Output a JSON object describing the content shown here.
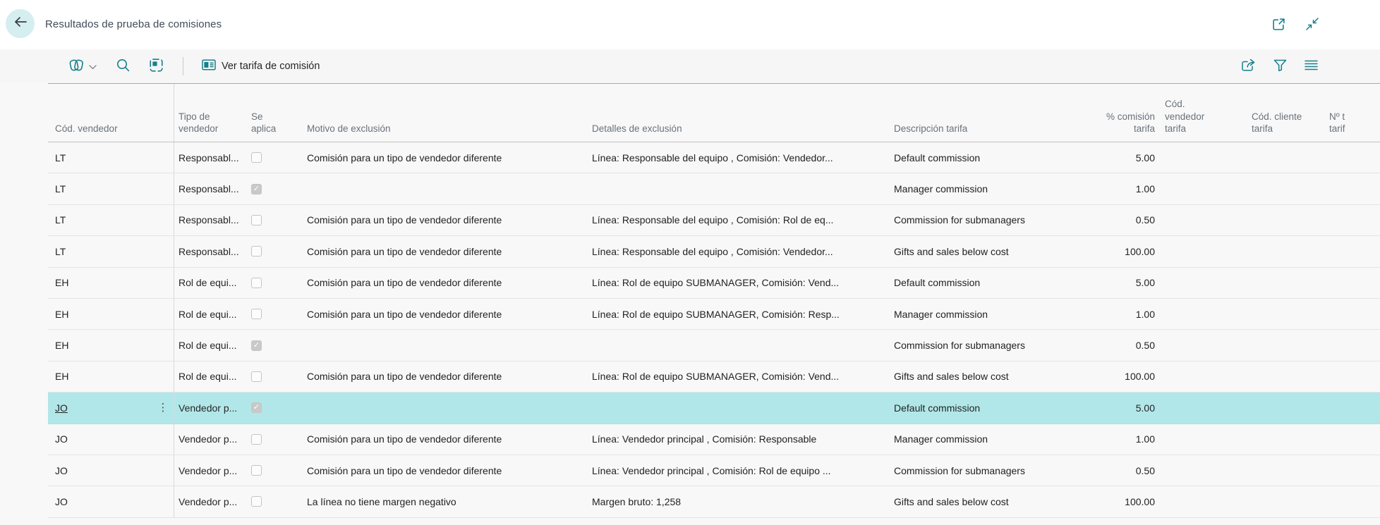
{
  "header": {
    "title": "Resultados de prueba de comisiones",
    "icons": [
      "back-arrow-icon",
      "open-in-new-window-icon",
      "collapse-icon"
    ]
  },
  "toolbar": {
    "icons": [
      "related-pages-icon",
      "chevron-down-icon",
      "search-icon",
      "analyze-icon",
      "card-icon",
      "share-icon",
      "filter-icon",
      "list-options-icon"
    ],
    "action_label": "Ver tarifa de comisión"
  },
  "colors": {
    "accent_teal": "#15808b",
    "selected_row_bg": "#b2e7e9",
    "back_circle_bg": "#d5eef0"
  },
  "table": {
    "columns": [
      {
        "label": "Cód. vendedor"
      },
      {
        "label": ""
      },
      {
        "label": "Tipo de\nvendedor"
      },
      {
        "label": "Se\naplica"
      },
      {
        "label": "Motivo de exclusión"
      },
      {
        "label": "Detalles de exclusión"
      },
      {
        "label": "Descripción tarifa"
      },
      {
        "label": "% comisión\ntarifa"
      },
      {
        "label": "Cód.\nvendedor\ntarifa"
      },
      {
        "label": "Cód. cliente\ntarifa"
      },
      {
        "label": "Nº t\ntarif"
      }
    ],
    "rows": [
      {
        "cod": "LT",
        "tipo": "Responsabl...",
        "aplica": false,
        "motivo": "Comisión para un tipo de vendedor diferente",
        "detalles": "Línea: Responsable del equipo , Comisión: Vendedor...",
        "desc": "Default commission",
        "pct": "5.00",
        "codv": "",
        "codc": "",
        "num": "",
        "selected": false
      },
      {
        "cod": "LT",
        "tipo": "Responsabl...",
        "aplica": true,
        "motivo": "",
        "detalles": "",
        "desc": "Manager commission",
        "pct": "1.00",
        "codv": "",
        "codc": "",
        "num": "",
        "selected": false
      },
      {
        "cod": "LT",
        "tipo": "Responsabl...",
        "aplica": false,
        "motivo": "Comisión para un tipo de vendedor diferente",
        "detalles": "Línea: Responsable del equipo , Comisión: Rol de eq...",
        "desc": "Commission for submanagers",
        "pct": "0.50",
        "codv": "",
        "codc": "",
        "num": "",
        "selected": false
      },
      {
        "cod": "LT",
        "tipo": "Responsabl...",
        "aplica": false,
        "motivo": "Comisión para un tipo de vendedor diferente",
        "detalles": "Línea: Responsable del equipo , Comisión: Vendedor...",
        "desc": "Gifts and sales below cost",
        "pct": "100.00",
        "codv": "",
        "codc": "",
        "num": "",
        "selected": false
      },
      {
        "cod": "EH",
        "tipo": "Rol de equi...",
        "aplica": false,
        "motivo": "Comisión para un tipo de vendedor diferente",
        "detalles": "Línea: Rol de equipo SUBMANAGER, Comisión: Vend...",
        "desc": "Default commission",
        "pct": "5.00",
        "codv": "",
        "codc": "",
        "num": "",
        "selected": false
      },
      {
        "cod": "EH",
        "tipo": "Rol de equi...",
        "aplica": false,
        "motivo": "Comisión para un tipo de vendedor diferente",
        "detalles": "Línea: Rol de equipo SUBMANAGER, Comisión: Resp...",
        "desc": "Manager commission",
        "pct": "1.00",
        "codv": "",
        "codc": "",
        "num": "",
        "selected": false
      },
      {
        "cod": "EH",
        "tipo": "Rol de equi...",
        "aplica": true,
        "motivo": "",
        "detalles": "",
        "desc": "Commission for submanagers",
        "pct": "0.50",
        "codv": "",
        "codc": "",
        "num": "",
        "selected": false
      },
      {
        "cod": "EH",
        "tipo": "Rol de equi...",
        "aplica": false,
        "motivo": "Comisión para un tipo de vendedor diferente",
        "detalles": "Línea: Rol de equipo SUBMANAGER, Comisión: Vend...",
        "desc": "Gifts and sales below cost",
        "pct": "100.00",
        "codv": "",
        "codc": "",
        "num": "",
        "selected": false
      },
      {
        "cod": "JO",
        "tipo": "Vendedor p...",
        "aplica": true,
        "motivo": "",
        "detalles": "",
        "desc": "Default commission",
        "pct": "5.00",
        "codv": "",
        "codc": "",
        "num": "",
        "selected": true
      },
      {
        "cod": "JO",
        "tipo": "Vendedor p...",
        "aplica": false,
        "motivo": "Comisión para un tipo de vendedor diferente",
        "detalles": "Línea: Vendedor principal , Comisión: Responsable",
        "desc": "Manager commission",
        "pct": "1.00",
        "codv": "",
        "codc": "",
        "num": "",
        "selected": false
      },
      {
        "cod": "JO",
        "tipo": "Vendedor p...",
        "aplica": false,
        "motivo": "Comisión para un tipo de vendedor diferente",
        "detalles": "Línea: Vendedor principal , Comisión: Rol de equipo ...",
        "desc": "Commission for submanagers",
        "pct": "0.50",
        "codv": "",
        "codc": "",
        "num": "",
        "selected": false
      },
      {
        "cod": "JO",
        "tipo": "Vendedor p...",
        "aplica": false,
        "motivo": "La línea no tiene margen negativo",
        "detalles": "Margen bruto: 1,258",
        "desc": "Gifts and sales below cost",
        "pct": "100.00",
        "codv": "",
        "codc": "",
        "num": "",
        "selected": false
      }
    ]
  }
}
